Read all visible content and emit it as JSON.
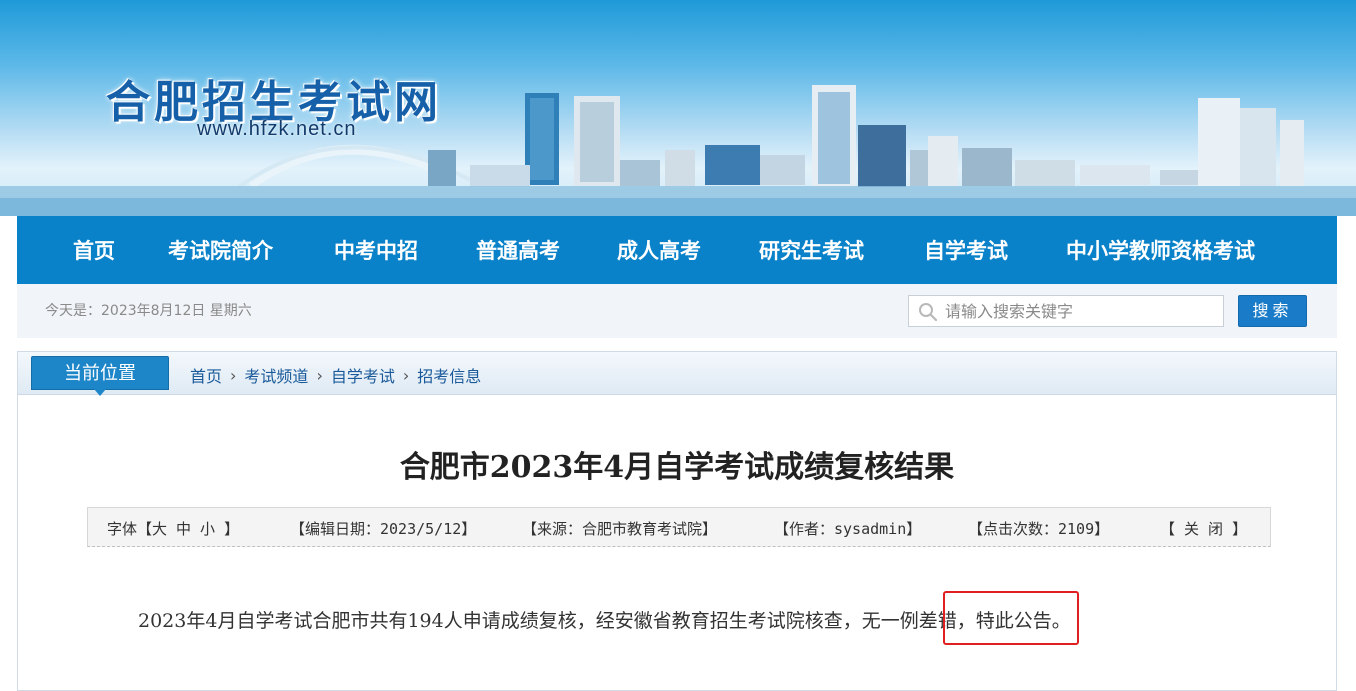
{
  "header": {
    "site_title": "合肥招生考试网",
    "site_url": "www.hfzk.net.cn"
  },
  "nav": {
    "items": [
      "首页",
      "考试院简介",
      "中考中招",
      "普通高考",
      "成人高考",
      "研究生考试",
      "自学考试",
      "中小学教师资格考试"
    ]
  },
  "infobar": {
    "today": "今天是：2023年8月12日 星期六",
    "search_placeholder": "请输入搜索关键字",
    "search_button": "搜索"
  },
  "breadcrumb": {
    "label": "当前位置",
    "items": [
      "首页",
      "考试频道",
      "自学考试",
      "招考信息"
    ]
  },
  "article": {
    "title": "合肥市2023年4月自学考试成绩复核结果",
    "meta": {
      "font_label": "字体【大 中 小 】",
      "edit_date": "【编辑日期：2023/5/12】",
      "source": "【来源：合肥市教育考试院】",
      "author": "【作者：sysadmin】",
      "clicks": "【点击次数：2109】",
      "close": "【 关 闭 】"
    },
    "body": "2023年4月自学考试合肥市共有194人申请成绩复核，经安徽省教育招生考试院核查，无一例差错，特此公告。"
  },
  "colors": {
    "nav_bg": "#0a82c9",
    "title_blue": "#1560a8",
    "highlight_red": "#e02020",
    "button_blue": "#1a7cc8"
  }
}
